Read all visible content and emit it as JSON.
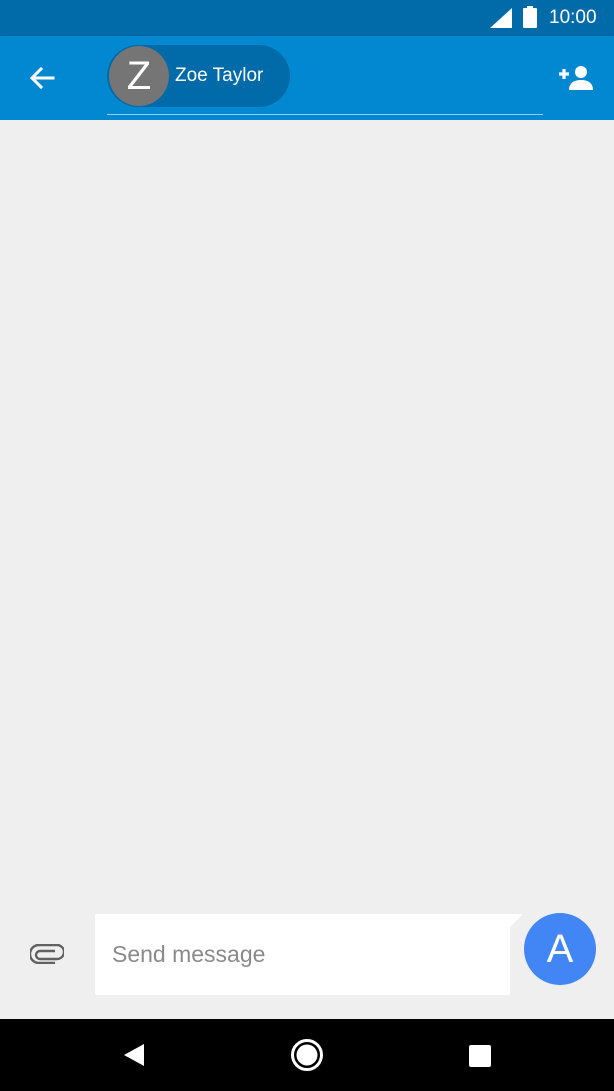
{
  "status_bar": {
    "time": "10:00",
    "icons": [
      "signal-icon",
      "battery-icon"
    ]
  },
  "app_bar": {
    "back_icon": "arrow-left-icon",
    "recipient": {
      "avatar_letter": "Z",
      "name": "Zoe Taylor"
    },
    "add_icon": "add-person-icon"
  },
  "compose": {
    "attach_icon": "paperclip-icon",
    "placeholder": "Send message",
    "value": "",
    "send_label": "A"
  },
  "nav_bar": {
    "icons": [
      "nav-back-icon",
      "nav-home-icon",
      "nav-recents-icon"
    ]
  },
  "colors": {
    "status_bar": "#016aa8",
    "app_bar": "#0288d1",
    "chip": "#016aa8",
    "avatar": "#757575",
    "background": "#efefef",
    "send_button": "#4285f4"
  }
}
